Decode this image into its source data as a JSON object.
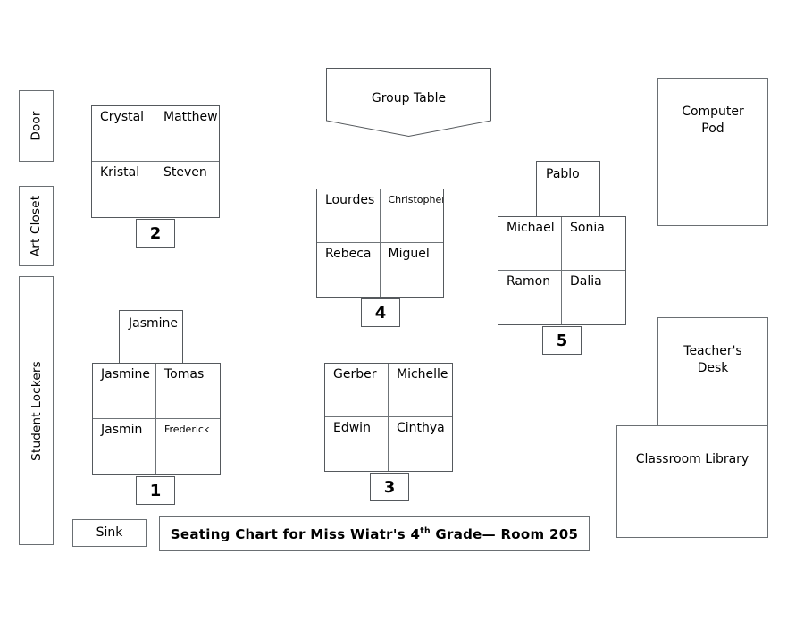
{
  "title_banner": {
    "text_before": "Seating Chart for Miss Wiatr's 4",
    "ordinal": "th",
    "text_after": " Grade— Room 205"
  },
  "room_features": {
    "door": "Door",
    "art_closet": "Art Closet",
    "student_lockers": "Student Lockers",
    "sink": "Sink",
    "group_table": "Group Table",
    "computer_pod": "Computer\nPod",
    "computer_pod_line1": "Computer",
    "computer_pod_line2": "Pod",
    "teachers_desk_line1": "Teacher's",
    "teachers_desk_line2": "Desk",
    "classroom_library": "Classroom Library"
  },
  "tables": [
    {
      "number": "1",
      "extra_seat": "Jasmine",
      "seats": [
        "Jasmine",
        "Tomas",
        "Jasmin",
        "Frederick"
      ],
      "small_text_seats": [
        3
      ]
    },
    {
      "number": "2",
      "extra_seat": null,
      "seats": [
        "Crystal",
        "Matthew",
        "Kristal",
        "Steven"
      ],
      "small_text_seats": []
    },
    {
      "number": "3",
      "extra_seat": null,
      "seats": [
        "Gerber",
        "Michelle",
        "Edwin",
        "Cinthya"
      ],
      "small_text_seats": []
    },
    {
      "number": "4",
      "extra_seat": null,
      "seats": [
        "Lourdes",
        "Christopher",
        "Rebeca",
        "Miguel"
      ],
      "small_text_seats": [
        1
      ]
    },
    {
      "number": "5",
      "extra_seat": "Pablo",
      "seats": [
        "Michael",
        "Sonia",
        "Ramon",
        "Dalia"
      ],
      "small_text_seats": []
    }
  ],
  "colors": {
    "background": "#ffffff",
    "stroke": "#55595d",
    "stroke_light": "#6a6f73",
    "text": "#000000"
  }
}
